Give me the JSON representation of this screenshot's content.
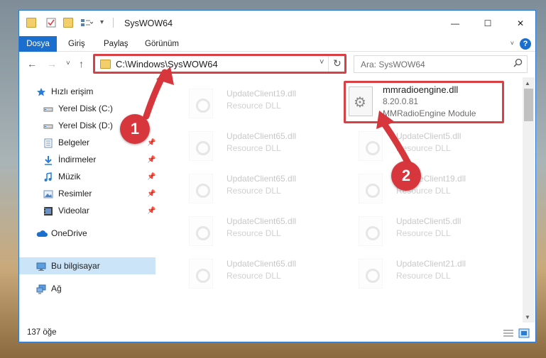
{
  "window": {
    "title": "SysWOW64",
    "minimize_glyph": "—",
    "maximize_glyph": "☐",
    "close_glyph": "✕"
  },
  "ribbon": {
    "tabs": [
      "Dosya",
      "Giriş",
      "Paylaş",
      "Görünüm"
    ],
    "collapse_glyph": "˅",
    "help_glyph": "?"
  },
  "navigation": {
    "back_glyph": "←",
    "forward_glyph": "→",
    "recent_glyph": "˅",
    "up_glyph": "↑",
    "address": "C:\\Windows\\SysWOW64",
    "address_dropdown_glyph": "˅",
    "refresh_glyph": "↻",
    "search_placeholder": "Ara: SysWOW64",
    "search_icon": "search-icon"
  },
  "sidebar": {
    "items": [
      {
        "label": "Hızlı erişim",
        "icon": "star-icon",
        "pinned": false
      },
      {
        "label": "Yerel Disk (C:)",
        "icon": "drive-icon",
        "pinned": false
      },
      {
        "label": "Yerel Disk (D:)",
        "icon": "drive-icon",
        "pinned": false
      },
      {
        "label": "Belgeler",
        "icon": "documents-icon",
        "pinned": true
      },
      {
        "label": "İndirmeler",
        "icon": "download-icon",
        "pinned": true
      },
      {
        "label": "Müzik",
        "icon": "music-icon",
        "pinned": true
      },
      {
        "label": "Resimler",
        "icon": "pictures-icon",
        "pinned": true
      },
      {
        "label": "Videolar",
        "icon": "videos-icon",
        "pinned": true
      },
      {
        "label": "OneDrive",
        "icon": "cloud-icon",
        "pinned": false
      },
      {
        "label": "Bu bilgisayar",
        "icon": "computer-icon",
        "pinned": false
      },
      {
        "label": "Ağ",
        "icon": "network-icon",
        "pinned": false
      }
    ],
    "selected": "Bu bilgisayar"
  },
  "files": {
    "faded": [
      {
        "name": "UpdateClient19.dll",
        "desc": "Resource DLL"
      },
      {
        "name": "UpdateClient65.dll",
        "desc": "Resource DLL"
      },
      {
        "name": "UpdateClient5.dll",
        "desc": "Resource DLL"
      },
      {
        "name": "UpdateClient65.dll",
        "desc": "Resource DLL"
      },
      {
        "name": "UpdateClient19.dll",
        "desc": "Resource DLL"
      },
      {
        "name": "UpdateClient65.dll",
        "desc": "Resource DLL"
      },
      {
        "name": "UpdateClient5.dll",
        "desc": "Resource DLL"
      },
      {
        "name": "UpdateClient65.dll",
        "desc": "Resource DLL"
      },
      {
        "name": "UpdateClient21.dll",
        "desc": "Resource DLL"
      }
    ],
    "target": {
      "name": "mmradioengine.dll",
      "version": "8.20.0.81",
      "desc": "MMRadioEngine Module",
      "icon": "gear-icon"
    }
  },
  "status": {
    "item_count": "137 öğe"
  },
  "annotations": {
    "marker_1": "1",
    "marker_2": "2",
    "highlight_color": "#d84046",
    "marker_color": "#d7373c"
  },
  "colors": {
    "accent": "#1a6fce",
    "selection": "#cce4f7"
  }
}
